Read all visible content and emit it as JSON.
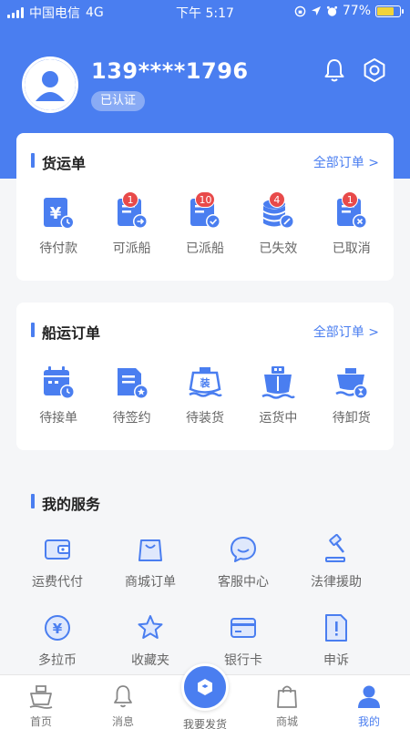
{
  "status_bar": {
    "carrier": "中国电信",
    "network": "4G",
    "time": "下午 5:17",
    "battery": "77%"
  },
  "profile": {
    "phone": "139****1796",
    "verified_label": "已认证"
  },
  "freight_orders": {
    "title": "货运单",
    "all_link": "全部订单 >",
    "items": [
      {
        "label": "待付款",
        "icon": "yuan-bill-clock-icon",
        "badge": ""
      },
      {
        "label": "可派船",
        "icon": "doc-arrow-icon",
        "badge": "1"
      },
      {
        "label": "已派船",
        "icon": "doc-check-icon",
        "badge": "10"
      },
      {
        "label": "已失效",
        "icon": "coins-slash-icon",
        "badge": "4"
      },
      {
        "label": "已取消",
        "icon": "doc-cross-icon",
        "badge": "1"
      }
    ]
  },
  "ship_orders": {
    "title": "船运订单",
    "all_link": "全部订单 >",
    "items": [
      {
        "label": "待接单",
        "icon": "calendar-clock-icon"
      },
      {
        "label": "待签约",
        "icon": "contract-stamp-icon"
      },
      {
        "label": "待装货",
        "icon": "ship-load-icon",
        "icon_text": "装"
      },
      {
        "label": "运货中",
        "icon": "ship-transit-icon"
      },
      {
        "label": "待卸货",
        "icon": "ship-unload-icon"
      }
    ]
  },
  "services": {
    "title": "我的服务",
    "items": [
      {
        "label": "运费代付",
        "icon": "wallet-icon"
      },
      {
        "label": "商城订单",
        "icon": "shopping-bag-icon"
      },
      {
        "label": "客服中心",
        "icon": "chat-bubble-icon"
      },
      {
        "label": "法律援助",
        "icon": "gavel-icon"
      },
      {
        "label": "多拉币",
        "icon": "yuan-coin-icon"
      },
      {
        "label": "收藏夹",
        "icon": "star-icon"
      },
      {
        "label": "银行卡",
        "icon": "bank-card-icon"
      },
      {
        "label": "申诉",
        "icon": "appeal-doc-icon"
      }
    ]
  },
  "tabbar": {
    "home": "首页",
    "messages": "消息",
    "post": "我要发货",
    "mall": "商城",
    "mine": "我的"
  },
  "colors": {
    "primary": "#4a7ef0",
    "badge": "#e84a4a",
    "background": "#f5f6f8"
  }
}
